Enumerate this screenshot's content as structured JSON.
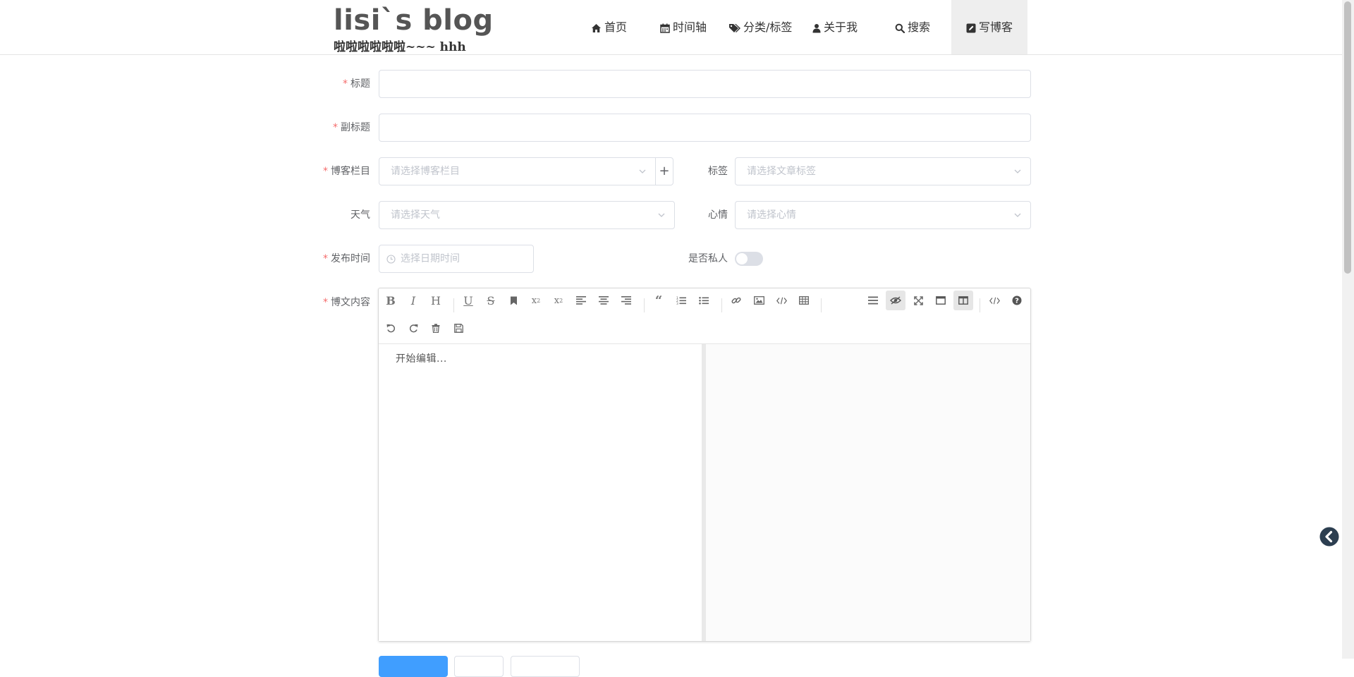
{
  "header": {
    "title": "lisi`s blog",
    "subtitle": "啦啦啦啦啦啦~~~ hhh",
    "nav": [
      {
        "label": "首页",
        "icon": "home-icon"
      },
      {
        "label": "时间轴",
        "icon": "calendar-icon"
      },
      {
        "label": "分类/标签",
        "icon": "tags-icon"
      },
      {
        "label": "关于我",
        "icon": "user-icon"
      },
      {
        "label": "搜索",
        "icon": "search-icon"
      },
      {
        "label": "写博客",
        "icon": "edit-icon",
        "active": true
      }
    ]
  },
  "form": {
    "title_label": "标题",
    "title_value": "",
    "subtitle_label": "副标题",
    "subtitle_value": "",
    "category_label": "博客栏目",
    "category_placeholder": "请选择博客栏目",
    "add_category_symbol": "+",
    "tag_label": "标签",
    "tag_placeholder": "请选择文章标签",
    "weather_label": "天气",
    "weather_placeholder": "请选择天气",
    "mood_label": "心情",
    "mood_placeholder": "请选择心情",
    "publish_time_label": "发布时间",
    "publish_time_placeholder": "选择日期时间",
    "private_label": "是否私人",
    "private_value": false,
    "content_label": "博文内容",
    "required_mark": "*"
  },
  "editor": {
    "placeholder": "开始编辑...",
    "toolbar": [
      "bold",
      "italic",
      "header",
      "underline",
      "strikethrough",
      "mark",
      "superscript",
      "subscript",
      "align-left",
      "align-center",
      "align-right",
      "quote",
      "ordered-list",
      "unordered-list",
      "link",
      "image",
      "code",
      "table",
      "navigation",
      "preview",
      "fullscreen",
      "read-mode",
      "subfield",
      "html-code",
      "help",
      "undo",
      "redo",
      "trash",
      "save"
    ],
    "active_buttons": [
      "preview",
      "subfield"
    ]
  },
  "colors": {
    "required": "#f56c6c",
    "primary": "#409eff",
    "header_text": "#333333",
    "nav_active_bg": "#eeeeee"
  }
}
